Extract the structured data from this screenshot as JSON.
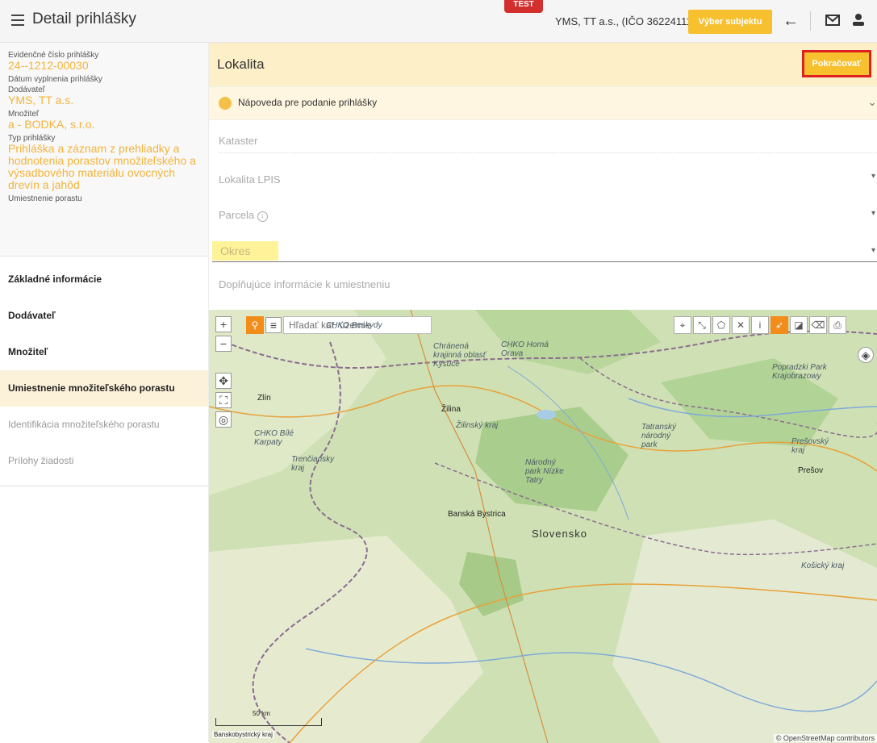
{
  "header": {
    "title": "Detail prihlášky",
    "test_badge": "TEST",
    "subject": "YMS, TT a.s., (IČO 36224111)",
    "select_subject": "Výber subjektu",
    "icons": [
      "menu-icon",
      "back-arrow-icon",
      "mail-icon",
      "user-icon"
    ]
  },
  "summary": {
    "app_number_label": "Evidenčné číslo prihlášky",
    "app_number": "24--1212-00030",
    "date_label": "Dátum vyplnenia prihlášky",
    "supplier_label": "Dodávateľ",
    "supplier": "YMS, TT a.s.",
    "propagator_label": "Množiteľ",
    "propagator": "a - BODKA, s.r.o.",
    "type_label": "Typ prihlášky",
    "type": "Prihláška a záznam z prehliadky a hodnotenia porastov množiteľského a výsadbového materiálu ovocných drevín a jahôd",
    "location_label": "Umiestnenie porastu"
  },
  "nav": [
    {
      "label": "Základné informácie"
    },
    {
      "label": "Dodávateľ"
    },
    {
      "label": "Množiteľ"
    },
    {
      "label": "Umiestnenie množiteľského porastu"
    },
    {
      "label": "Identifikácia množiteľského porastu"
    },
    {
      "label": "Prílohy žiadosti"
    }
  ],
  "section": {
    "title": "Lokalita",
    "continue": "Pokračovať",
    "help": "Nápoveda pre podanie prihlášky"
  },
  "fields": {
    "kataster": "Kataster",
    "lpis": "Lokalita LPIS",
    "parcela": "Parcela",
    "okres": "Okres",
    "doplnujuce": "Doplňujúce informácie k umiestneniu"
  },
  "map": {
    "search_placeholder": "Hľadať kat. územie",
    "scale": "50 km",
    "region": "Banskobystrický kraj",
    "attribution": "© OpenStreetMap contributors",
    "labels": {
      "chko_beskydy": "CHKO Beskydy",
      "chranena": "Chránená krajinná oblasť Kysuce",
      "chko_horna": "CHKO Horná Orava",
      "popradzki": "Popradzki Park Krajobrazowy",
      "zlin": "Zlín",
      "zilina": "Žilina",
      "zilinsky": "Žilinský kraj",
      "tatransky": "Tatranský národný park",
      "chko_biele": "CHKO Bílé Karpaty",
      "trenciansky": "Trenčiansky kraj",
      "presovsky": "Prešovský kraj",
      "presov": "Prešov",
      "nizke_tatry": "Národný park Nízke Tatry",
      "banska": "Banská Bystrica",
      "slovensko": "Slovensko",
      "kosicky": "Košický kraj"
    }
  }
}
